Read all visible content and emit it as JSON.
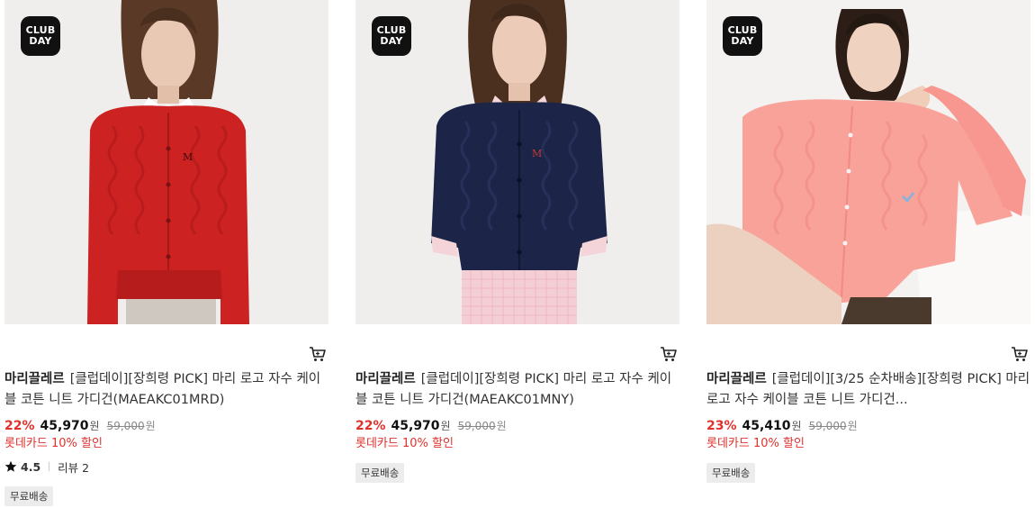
{
  "badge": {
    "line1": "CLUB",
    "line2": "DAY"
  },
  "products": [
    {
      "brand": "마리끌레르",
      "name": "[클럽데이][장희령 PICK] 마리 로고 자수 케이블 코튼 니트 가디건(MAEAKC01MRD)",
      "discount": "22%",
      "price": "45,970",
      "currency": "원",
      "original_price": "59,000",
      "card_promo": "롯데카드 10% 할인",
      "rating": "4.5",
      "review_label": "리뷰 2",
      "shipping": "무료배송",
      "sweater_color": "#cc2222",
      "bg_color": "#efeeec"
    },
    {
      "brand": "마리끌레르",
      "name": "[클럽데이][장희령 PICK] 마리 로고 자수 케이블 코튼 니트 가디건(MAEAKC01MNY)",
      "discount": "22%",
      "price": "45,970",
      "currency": "원",
      "original_price": "59,000",
      "card_promo": "롯데카드 10% 할인",
      "shipping": "무료배송",
      "sweater_color": "#1c2447",
      "bg_color": "#efeeec"
    },
    {
      "brand": "마리끌레르",
      "name": "[클럽데이][3/25 순차배송][장희령 PICK] 마리 로고 자수 케이블 코튼 니트 가디건...",
      "discount": "23%",
      "price": "45,410",
      "currency": "원",
      "original_price": "59,000",
      "card_promo": "롯데카드 10% 할인",
      "shipping": "무료배송",
      "sweater_color": "#f9a29a",
      "bg_color": "#f3f2f0"
    }
  ],
  "icons": {
    "cart": "cart-icon",
    "star": "star-icon"
  }
}
